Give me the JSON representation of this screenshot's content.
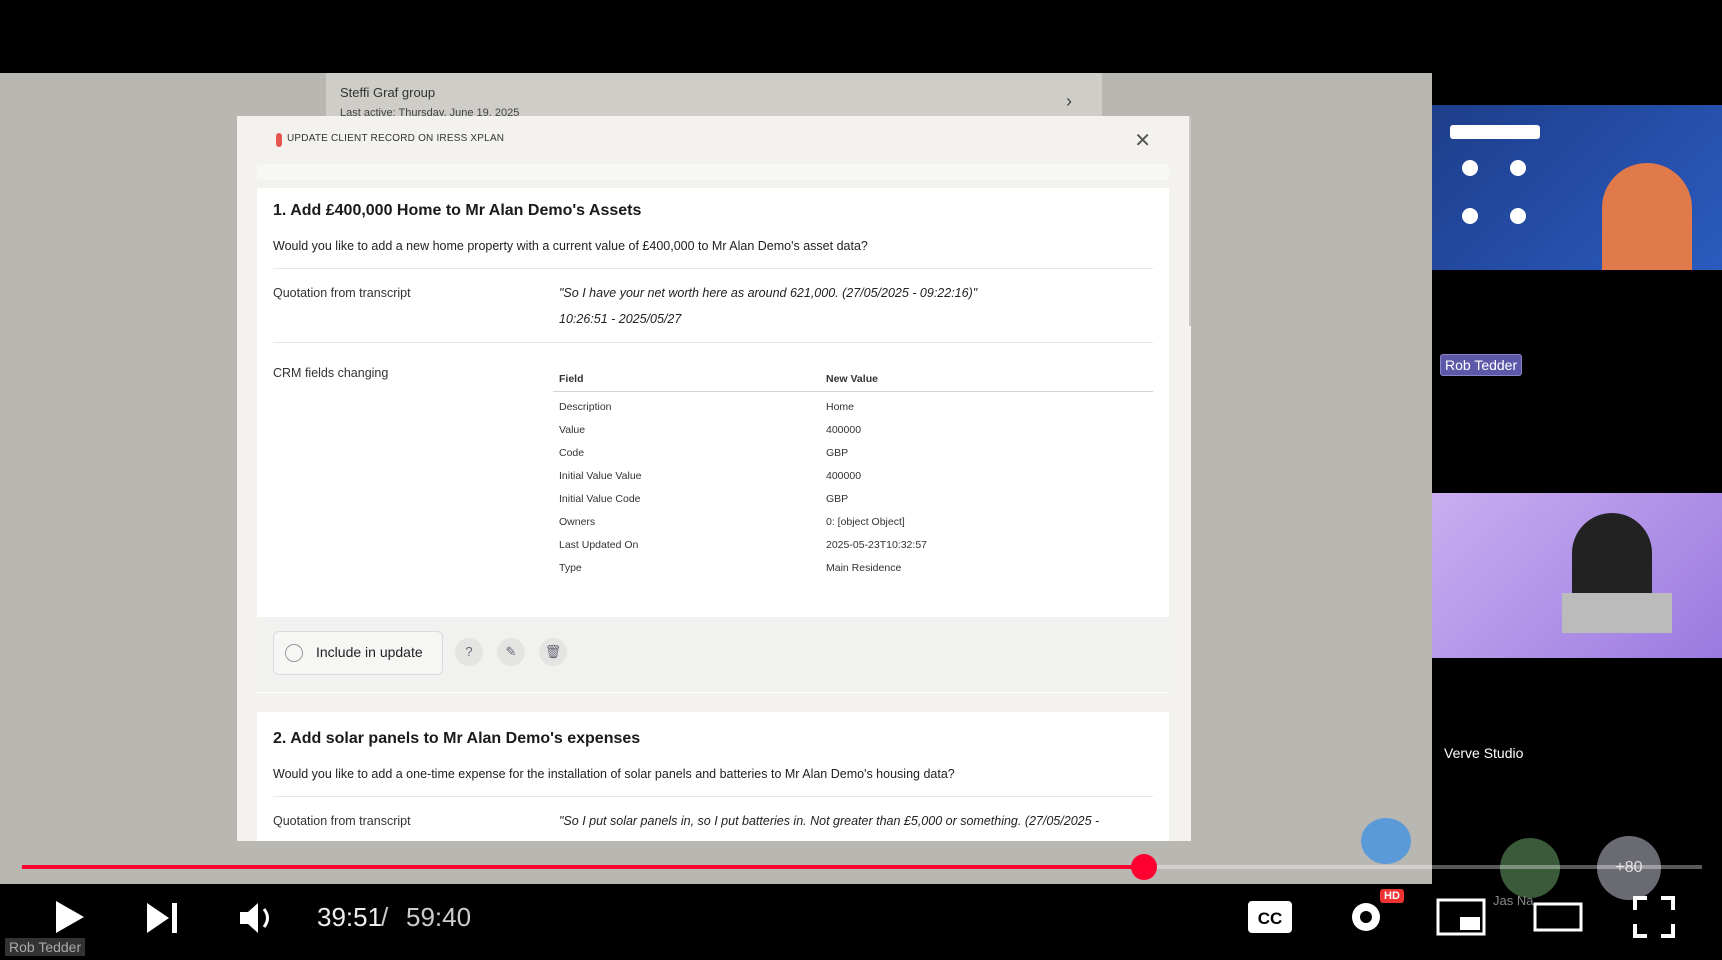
{
  "background_card": {
    "title": "Steffi Graf group",
    "subtitle": "Last active: Thursday, June 19, 2025"
  },
  "modal": {
    "title": "UPDATE CLIENT RECORD ON IRESS XPLAN",
    "close_icon": "close-icon",
    "item1": {
      "title": "1. Add £400,000 Home to Mr Alan Demo's Assets",
      "question": "Would you like to add a new home property with a current value of £400,000 to Mr Alan Demo's asset data?",
      "quotation_label": "Quotation from transcript",
      "quotation": "\"So I have your net worth here as around 621,000. (27/05/2025 - 09:22:16)\"",
      "quotation_time": "10:26:51 - 2025/05/27",
      "crm_label": "CRM fields changing",
      "table": {
        "headers": [
          "Field",
          "New Value"
        ],
        "rows": [
          [
            "Description",
            "Home"
          ],
          [
            "Value",
            "400000"
          ],
          [
            "Code",
            "GBP"
          ],
          [
            "Initial Value Value",
            "400000"
          ],
          [
            "Initial Value Code",
            "GBP"
          ],
          [
            "Owners",
            "0: [object Object]"
          ],
          [
            "Last Updated On",
            "2025-05-23T10:32:57"
          ],
          [
            "Type",
            "Main Residence"
          ]
        ]
      },
      "include_label": "Include in update",
      "help_icon": "question-icon",
      "edit_icon": "pencil-icon",
      "delete_icon": "trash-icon"
    },
    "item2": {
      "title": "2. Add solar panels to Mr Alan Demo's expenses",
      "question": "Would you like to add a one-time expense for the installation of solar panels and batteries to Mr Alan Demo's housing data?",
      "quotation_label": "Quotation from transcript",
      "quotation": "\"So I put solar panels in, so I put batteries in. Not greater than £5,000 or something. (27/05/2025 -"
    }
  },
  "participants": {
    "speaker_name": "Rob Tedder",
    "studio_name": "Verve Studio",
    "extra_count": "+80",
    "avatar_name": "Jas Na..."
  },
  "player": {
    "time_current": "39:51",
    "time_separator": "/",
    "time_total": "59:40",
    "progress": 0.668,
    "corner_name": "Rob Tedder",
    "hd_badge": "HD",
    "colors": {
      "accent": "#ff0033"
    }
  }
}
